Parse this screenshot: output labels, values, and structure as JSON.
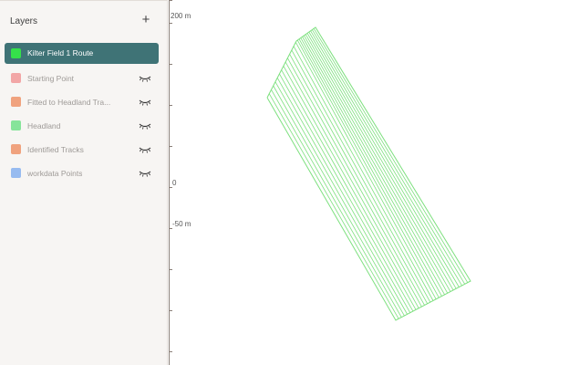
{
  "sidebar": {
    "title": "Layers",
    "add_symbol": "+",
    "layers": [
      {
        "label": "Kilter Field 1 Route",
        "color": "#35e04a",
        "active": true,
        "icon": "none"
      },
      {
        "label": "Starting Point",
        "color": "#f2a6a6",
        "active": false,
        "icon": "eye-closed-icon"
      },
      {
        "label": "Fitted to Headland Tra...",
        "color": "#f0a27e",
        "active": false,
        "icon": "eye-closed-icon"
      },
      {
        "label": "Headland",
        "color": "#86e49a",
        "active": false,
        "icon": "eye-closed-icon"
      },
      {
        "label": "Identified Tracks",
        "color": "#f0a27e",
        "active": false,
        "icon": "eye-closed-icon"
      },
      {
        "label": "workdata Points",
        "color": "#97bbf0",
        "active": false,
        "icon": "eye-closed-icon"
      }
    ]
  },
  "map": {
    "axis_labels": [
      {
        "text": "200 m"
      },
      {
        "text": "0"
      },
      {
        "text": "-50 m"
      }
    ],
    "route_color": "#7de07e"
  }
}
